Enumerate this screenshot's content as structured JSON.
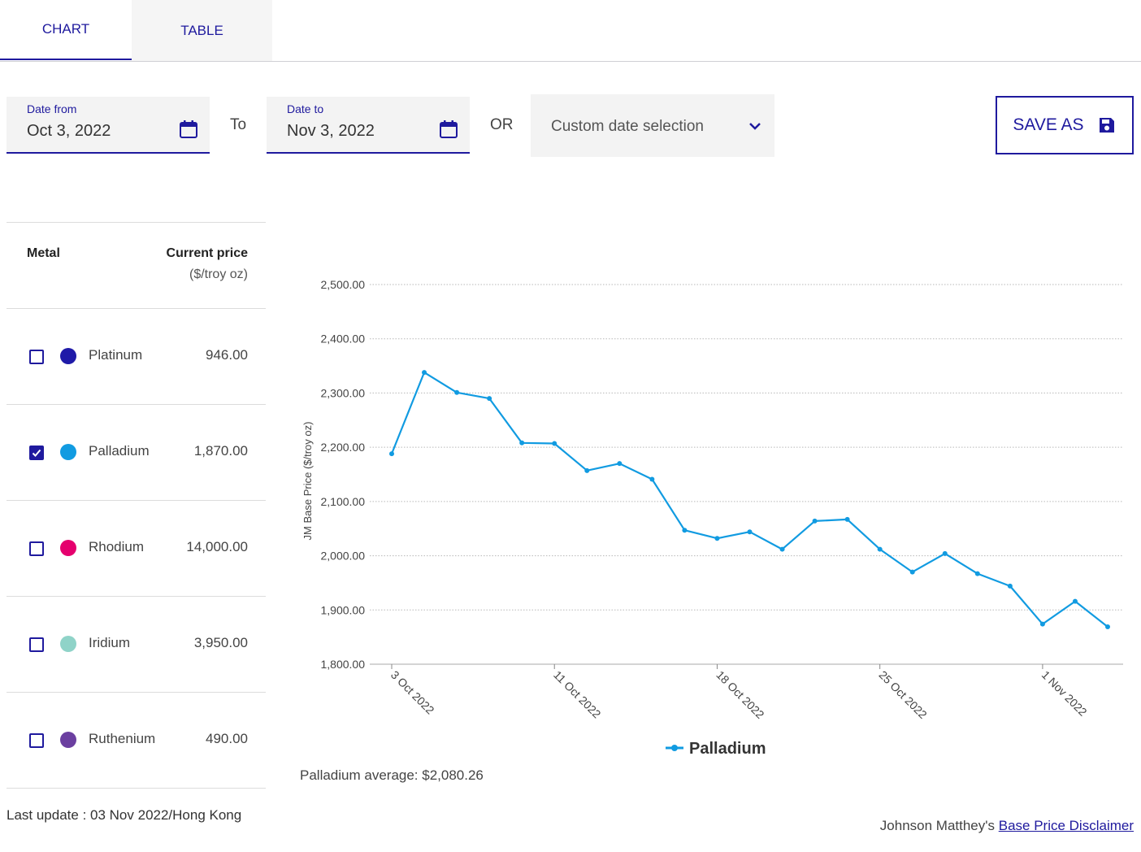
{
  "tabs": {
    "chart": "CHART",
    "table": "TABLE"
  },
  "date_from": {
    "label": "Date from",
    "value": "Oct 3, 2022"
  },
  "to_text": "To",
  "date_to": {
    "label": "Date to",
    "value": "Nov 3, 2022"
  },
  "or_text": "OR",
  "custom_select": {
    "value": "Custom date selection"
  },
  "save_button": {
    "label": "SAVE AS"
  },
  "metals_table": {
    "header_metal": "Metal",
    "header_price": "Current price",
    "header_unit": "($/troy oz)",
    "rows": [
      {
        "name": "Platinum",
        "price": "946.00",
        "color": "#1f1aa8",
        "checked": false
      },
      {
        "name": "Palladium",
        "price": "1,870.00",
        "color": "#119be1",
        "checked": true
      },
      {
        "name": "Rhodium",
        "price": "14,000.00",
        "color": "#e5006e",
        "checked": false
      },
      {
        "name": "Iridium",
        "price": "3,950.00",
        "color": "#8fd3c8",
        "checked": false
      },
      {
        "name": "Ruthenium",
        "price": "490.00",
        "color": "#6b3fa0",
        "checked": false
      }
    ]
  },
  "last_update": "Last update : 03 Nov 2022/Hong Kong",
  "average_text": "Palladium average: $2,080.26",
  "disclaimer": {
    "prefix": "Johnson Matthey's ",
    "link": "Base Price Disclaimer"
  },
  "colors": {
    "accent": "#1f1a9e",
    "series": "#119be1"
  },
  "chart_data": {
    "type": "line",
    "ylabel": "JM Base Price ($/troy oz)",
    "ylim": [
      1800,
      2500
    ],
    "yticks": [
      "1,800.00",
      "1,900.00",
      "2,000.00",
      "2,100.00",
      "2,200.00",
      "2,300.00",
      "2,400.00",
      "2,500.00"
    ],
    "ytick_values": [
      1800,
      1900,
      2000,
      2100,
      2200,
      2300,
      2400,
      2500
    ],
    "xticks": [
      "3 Oct 2022",
      "11 Oct 2022",
      "18 Oct 2022",
      "25 Oct 2022",
      "1 Nov 2022"
    ],
    "xtick_index": [
      0,
      5,
      10,
      15,
      20
    ],
    "grid": true,
    "legend_position": "bottom-center",
    "series": [
      {
        "name": "Palladium",
        "color": "#119be1",
        "values": [
          2188,
          2338,
          2301,
          2290,
          2208,
          2207,
          2157,
          2170,
          2141,
          2047,
          2032,
          2044,
          2012,
          2064,
          2067,
          2012,
          1970,
          2004,
          1967,
          1944,
          1874,
          1916,
          1869
        ]
      }
    ]
  }
}
